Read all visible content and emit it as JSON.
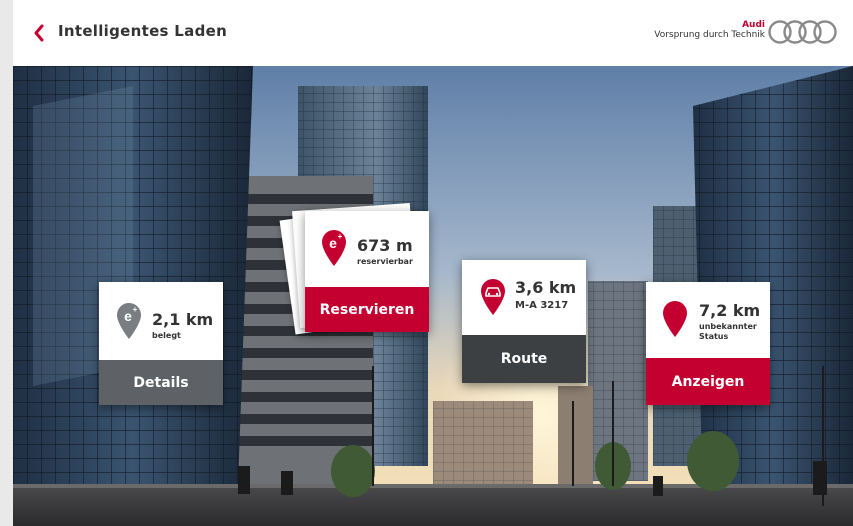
{
  "header": {
    "title": "Intelligentes Laden",
    "brand_name": "Audi",
    "brand_slogan": "Vorsprung durch Technik"
  },
  "colors": {
    "accent_red": "#c3002f",
    "gray_action": "#5e6266",
    "dark_action": "#3c4043",
    "pin_gray": "#7a7e82"
  },
  "cards": {
    "details": {
      "value": "2,1 km",
      "sub": "belegt",
      "action": "Details",
      "icon": "ev-charging-pin-icon"
    },
    "reserve": {
      "value": "673 m",
      "sub": "reservierbar",
      "action": "Reservieren",
      "icon": "ev-charging-pin-icon"
    },
    "route": {
      "value": "3,6 km",
      "sub": "M-A 3217",
      "action": "Route",
      "icon": "car-pin-icon"
    },
    "show": {
      "value": "7,2 km",
      "sub1": "unbekannter",
      "sub2": "Status",
      "action": "Anzeigen",
      "icon": "location-pin-icon"
    }
  }
}
